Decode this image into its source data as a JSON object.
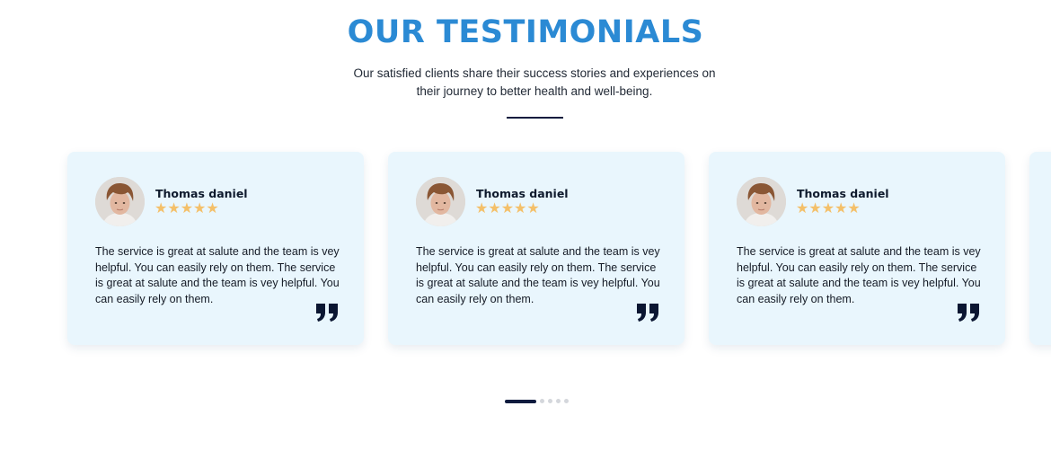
{
  "section": {
    "title": "OUR TESTIMONIALS",
    "subtitle": "Our satisfied clients share their success stories and experiences on their journey to better health and well-being."
  },
  "testimonials": [
    {
      "name": "Thomas daniel",
      "rating": 5,
      "stars": "★★★★★",
      "text": "The service is great at salute and the team is vey helpful. You can easily rely on them. The service is great at salute and the team is vey helpful. You can easily rely on them."
    },
    {
      "name": "Thomas daniel",
      "rating": 5,
      "stars": "★★★★★",
      "text": "The service is great at salute and the team is vey helpful. You can easily rely on them. The service is great at salute and the team is vey helpful. You can easily rely on them."
    },
    {
      "name": "Thomas daniel",
      "rating": 5,
      "stars": "★★★★★",
      "text": "The service is great at salute and the team is vey helpful. You can easily rely on them. The service is great at salute and the team is vey helpful. You can easily rely on them."
    }
  ],
  "carousel": {
    "slide_count": 5,
    "active_slide": 1
  },
  "colors": {
    "title": "#2b8ad4",
    "card_bg": "#e9f6fd",
    "star": "#f4c06a",
    "dark_accent": "#0d1b3e"
  },
  "icons": {
    "quote": "quote-icon",
    "star": "star-icon",
    "avatar": "avatar"
  }
}
